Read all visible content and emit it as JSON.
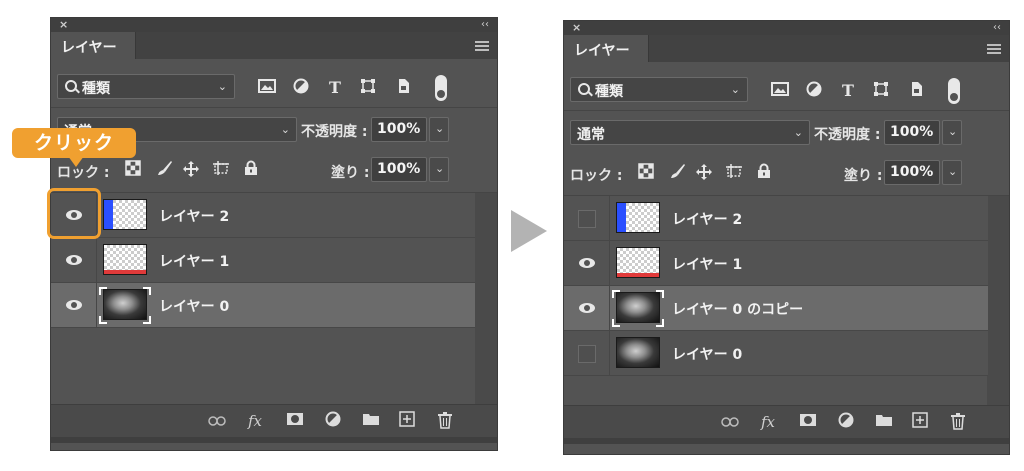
{
  "callout": {
    "label": "クリック",
    "color": "#f0a030"
  },
  "before": {
    "close_glyph": "×",
    "collapse_glyph": "‹‹",
    "tab_label": "レイヤー",
    "filter": {
      "value": "種類"
    },
    "blend": {
      "value": "通常"
    },
    "opacity": {
      "label": "不透明度 :",
      "value": "100%"
    },
    "lock": {
      "label": "ロック :"
    },
    "fill": {
      "label": "塗り :",
      "value": "100%"
    },
    "layers": [
      {
        "name": "レイヤー 2",
        "visible": true,
        "thumb": "blue-transparent"
      },
      {
        "name": "レイヤー 1",
        "visible": true,
        "thumb": "red-transparent"
      },
      {
        "name": "レイヤー 0",
        "visible": true,
        "thumb": "photo",
        "selected": true
      }
    ]
  },
  "after": {
    "close_glyph": "×",
    "collapse_glyph": "‹‹",
    "tab_label": "レイヤー",
    "filter": {
      "value": "種類"
    },
    "blend": {
      "value": "通常"
    },
    "opacity": {
      "label": "不透明度 :",
      "value": "100%"
    },
    "lock": {
      "label": "ロック :"
    },
    "fill": {
      "label": "塗り :",
      "value": "100%"
    },
    "layers": [
      {
        "name": "レイヤー 2",
        "visible": false,
        "thumb": "blue-transparent"
      },
      {
        "name": "レイヤー 1",
        "visible": true,
        "thumb": "red-transparent"
      },
      {
        "name": "レイヤー 0 のコピー",
        "visible": true,
        "thumb": "photo",
        "selected": true
      },
      {
        "name": "レイヤー 0",
        "visible": false,
        "thumb": "photo"
      }
    ]
  },
  "icons": {
    "filter_icons": [
      "image-icon",
      "adjustment-icon",
      "type-icon",
      "shape-icon",
      "smart-object-icon"
    ],
    "lock_icons": [
      "lock-transparent-icon",
      "lock-paint-icon",
      "lock-move-icon",
      "lock-artboard-icon",
      "lock-all-icon"
    ],
    "bottom_icons": [
      "link-icon",
      "fx-icon",
      "mask-icon",
      "adjustment-layer-icon",
      "folder-icon",
      "new-layer-icon",
      "trash-icon"
    ],
    "type_glyph": "T",
    "fx_glyph": "fx"
  }
}
